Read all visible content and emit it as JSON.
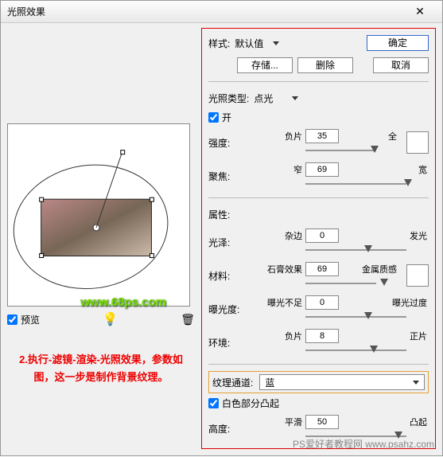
{
  "title": "光照效果",
  "buttons": {
    "ok": "确定",
    "cancel": "取消",
    "save": "存储...",
    "delete": "删除"
  },
  "style": {
    "label": "样式:",
    "value": "默认值"
  },
  "lightType": {
    "label": "光照类型:",
    "value": "点光"
  },
  "on": {
    "label": "开",
    "checked": true
  },
  "intensity": {
    "label": "强度:",
    "left": "负片",
    "right": "全",
    "value": "35",
    "pos": 70
  },
  "focus": {
    "label": "聚焦:",
    "left": "窄",
    "right": "宽",
    "value": "69",
    "pos": 80
  },
  "props": "属性:",
  "gloss": {
    "label": "光泽:",
    "left": "杂边",
    "right": "发光",
    "value": "0",
    "pos": 48
  },
  "material": {
    "label": "材料:",
    "left": "石膏效果",
    "right": "金属质感",
    "value": "69",
    "pos": 80
  },
  "exposure": {
    "label": "曝光度:",
    "left": "曝光不足",
    "right": "曝光过度",
    "value": "0",
    "pos": 48
  },
  "ambience": {
    "label": "环境:",
    "left": "负片",
    "right": "正片",
    "value": "8",
    "pos": 52
  },
  "texture": {
    "label": "纹理通道:",
    "value": "蓝"
  },
  "whiteHigh": {
    "label": "白色部分凸起",
    "checked": true
  },
  "height": {
    "label": "高度:",
    "left": "平滑",
    "right": "凸起",
    "value": "50",
    "pos": 72
  },
  "preview": {
    "label": "预览",
    "checked": true
  },
  "note": "2.执行-滤镜-渲染-光照效果，参数如图，这一步是制作背景纹理。",
  "watermark1": "www.68ps.com",
  "watermark2": "PS爱好者教程网  www.psahz.com"
}
